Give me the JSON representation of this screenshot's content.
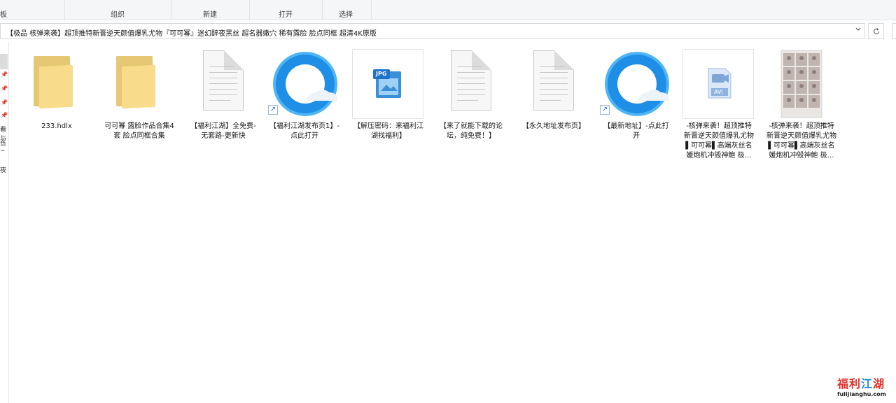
{
  "ribbon": {
    "left_partial": "板",
    "groups": [
      "组织",
      "新建",
      "打开",
      "选择"
    ]
  },
  "address": {
    "path": "【极品 核弹来袭】超顶推特新晋逆天颜值爆乳尤物『可可幂』迷幻醉夜黑丝 超名器嫩穴 稀有露脸 脸点同框 超清4K原版",
    "separator": "›",
    "dropdown_icon": "chevron-down-icon",
    "refresh_icon": "refresh-icon"
  },
  "navpane": {
    "partial_labels": [
      "看与",
      "负~",
      "夜"
    ]
  },
  "files": [
    {
      "name": "233.hdlx",
      "type": "folder"
    },
    {
      "name": "可可幂 露脸作品合集4套 脸点同框合集",
      "type": "folder"
    },
    {
      "name": "【福利江湖】全免费-无套路-更新快",
      "type": "document"
    },
    {
      "name": "【福利江湖发布页1】-点此打开",
      "type": "shortcut-browser"
    },
    {
      "name": "【解压密码：来福利江湖找福利】",
      "type": "jpg",
      "badge": "JPG"
    },
    {
      "name": "【来了就能下载的论坛，纯免费！】",
      "type": "document"
    },
    {
      "name": "【永久地址发布页】",
      "type": "document"
    },
    {
      "name": "【最新地址】-点此打开",
      "type": "shortcut-browser"
    },
    {
      "name": "-核弹来袭！超顶推特新晋逆天颜值爆乳尤物 ▌可可幂▌高端灰丝名媛炮机冲毁神鲍 极…",
      "type": "avi",
      "badge": "AVI"
    },
    {
      "name": "-核弹来袭！超顶推特新晋逆天颜值爆乳尤物 ▌可可幂▌高端灰丝名媛炮机冲毁神鲍 极…",
      "type": "image-thumbnail"
    }
  ],
  "watermark": {
    "title_red1": "福利",
    "title_blue": "江",
    "title_red2": "湖",
    "url": "fulijianghu.com"
  },
  "colors": {
    "folder": "#f8dc8c",
    "browser_blue": "#1e8ee6",
    "accent_red": "#e0312b"
  }
}
